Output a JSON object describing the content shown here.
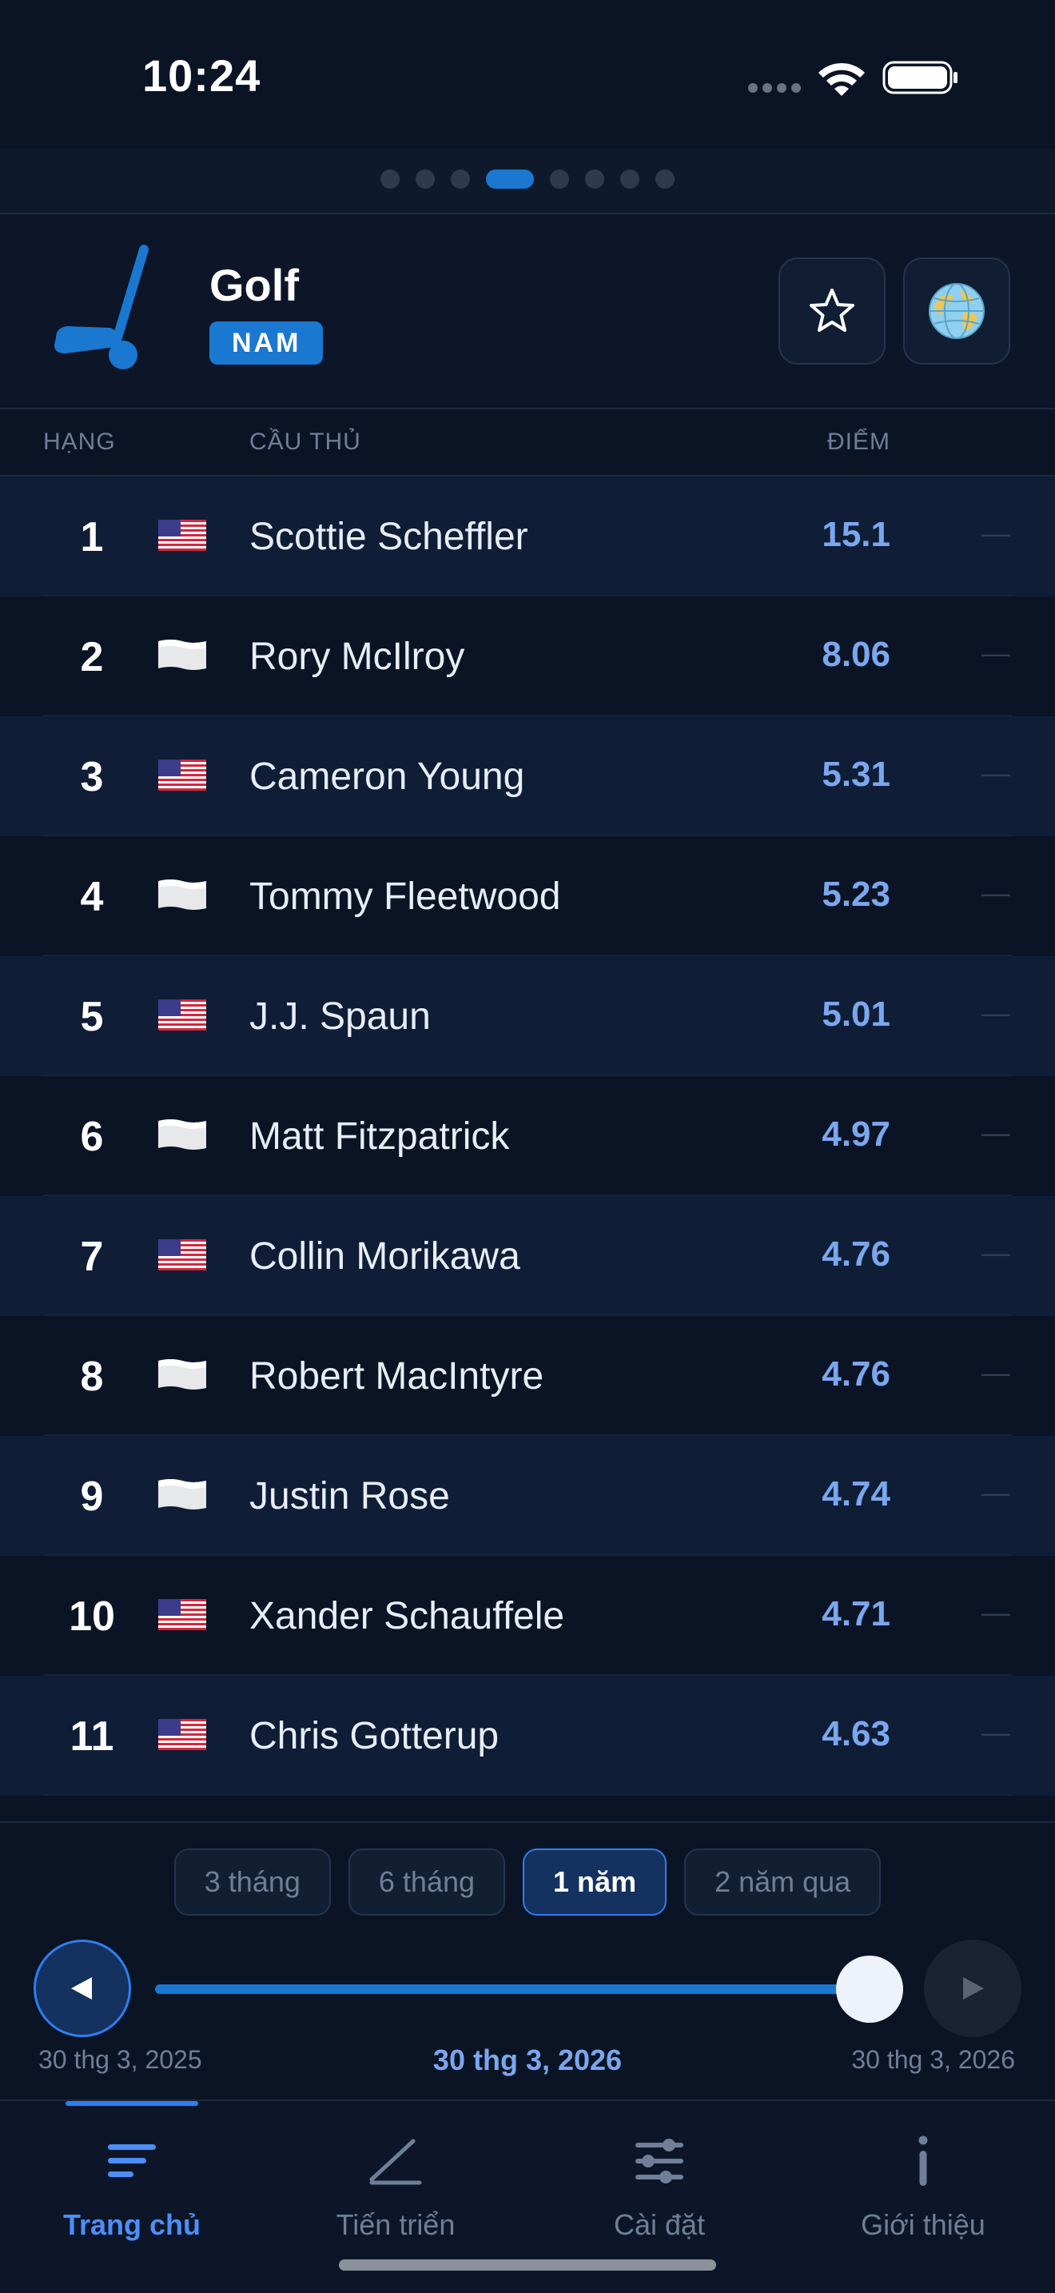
{
  "status_bar": {
    "time": "10:24"
  },
  "header": {
    "sport": "Golf",
    "gender_badge": "NAM",
    "logo_icon": "golf-club-icon",
    "favorite_icon": "star-icon",
    "globe_icon": "globe-icon",
    "page_dots": {
      "count": 8,
      "active_index": 3
    }
  },
  "columns": {
    "rank": "HẠNG",
    "player": "CẦU THỦ",
    "points": "ĐIỂM"
  },
  "rankings": [
    {
      "rank": "1",
      "flag": "us",
      "player": "Scottie Scheffler",
      "points": "15.1",
      "change": "—"
    },
    {
      "rank": "2",
      "flag": "white",
      "player": "Rory McIlroy",
      "points": "8.06",
      "change": "—"
    },
    {
      "rank": "3",
      "flag": "us",
      "player": "Cameron Young",
      "points": "5.31",
      "change": "—"
    },
    {
      "rank": "4",
      "flag": "white",
      "player": "Tommy Fleetwood",
      "points": "5.23",
      "change": "—"
    },
    {
      "rank": "5",
      "flag": "us",
      "player": "J.J. Spaun",
      "points": "5.01",
      "change": "—"
    },
    {
      "rank": "6",
      "flag": "white",
      "player": "Matt Fitzpatrick",
      "points": "4.97",
      "change": "—"
    },
    {
      "rank": "7",
      "flag": "us",
      "player": "Collin Morikawa",
      "points": "4.76",
      "change": "—"
    },
    {
      "rank": "8",
      "flag": "white",
      "player": "Robert MacIntyre",
      "points": "4.76",
      "change": "—"
    },
    {
      "rank": "9",
      "flag": "white",
      "player": "Justin Rose",
      "points": "4.74",
      "change": "—"
    },
    {
      "rank": "10",
      "flag": "us",
      "player": "Xander Schauffele",
      "points": "4.71",
      "change": "—"
    },
    {
      "rank": "11",
      "flag": "us",
      "player": "Chris Gotterup",
      "points": "4.63",
      "change": "—"
    }
  ],
  "range": {
    "tabs": [
      "3 tháng",
      "6 tháng",
      "1 năm",
      "2 năm qua"
    ],
    "active_tab": 2,
    "slider_position": 1.0,
    "date_start": "30 thg 3, 2025",
    "date_current": "30 thg 3, 2026",
    "date_end": "30 thg 3, 2026"
  },
  "tab_bar": {
    "items": [
      {
        "label": "Trang chủ",
        "icon": "home-lines-icon",
        "active": true
      },
      {
        "label": "Tiến triển",
        "icon": "progress-chart-icon",
        "active": false
      },
      {
        "label": "Cài đặt",
        "icon": "sliders-icon",
        "active": false
      },
      {
        "label": "Giới thiệu",
        "icon": "info-icon",
        "active": false
      }
    ]
  },
  "colors": {
    "accent": "#1a78d0",
    "points": "#7aa7ee",
    "active_tab": "#4d8ef7",
    "background": "#0b1424"
  }
}
